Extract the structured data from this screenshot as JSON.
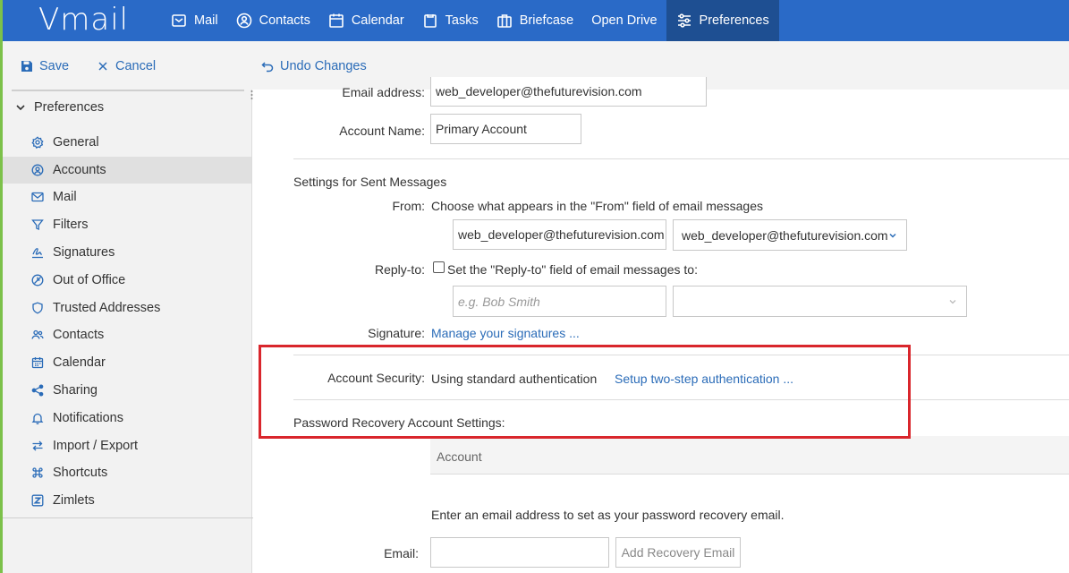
{
  "app": {
    "logo": "Vmail"
  },
  "nav": [
    {
      "label": "Mail",
      "icon": "mail-icon"
    },
    {
      "label": "Contacts",
      "icon": "contacts-icon"
    },
    {
      "label": "Calendar",
      "icon": "calendar-icon"
    },
    {
      "label": "Tasks",
      "icon": "tasks-icon"
    },
    {
      "label": "Briefcase",
      "icon": "briefcase-icon"
    },
    {
      "label": "Open Drive",
      "icon": ""
    },
    {
      "label": "Preferences",
      "icon": "sliders-icon"
    }
  ],
  "toolbar": {
    "save": "Save",
    "cancel": "Cancel",
    "undo": "Undo Changes"
  },
  "sidebar": {
    "header": "Preferences",
    "items": [
      {
        "label": "General",
        "icon": "gear-icon"
      },
      {
        "label": "Accounts",
        "icon": "account-icon"
      },
      {
        "label": "Mail",
        "icon": "mail-icon"
      },
      {
        "label": "Filters",
        "icon": "filter-icon"
      },
      {
        "label": "Signatures",
        "icon": "signature-icon"
      },
      {
        "label": "Out of Office",
        "icon": "out-of-office-icon"
      },
      {
        "label": "Trusted Addresses",
        "icon": "shield-icon"
      },
      {
        "label": "Contacts",
        "icon": "contacts-icon"
      },
      {
        "label": "Calendar",
        "icon": "calendar-icon"
      },
      {
        "label": "Sharing",
        "icon": "share-icon"
      },
      {
        "label": "Notifications",
        "icon": "bell-icon"
      },
      {
        "label": "Import / Export",
        "icon": "import-export-icon"
      },
      {
        "label": "Shortcuts",
        "icon": "command-icon"
      },
      {
        "label": "Zimlets",
        "icon": "zimlet-icon"
      }
    ]
  },
  "account": {
    "email_label": "Email address:",
    "email_value": "web_developer@thefuturevision.com",
    "name_label": "Account Name:",
    "name_value": "Primary Account"
  },
  "sent": {
    "section_title": "Settings for Sent Messages",
    "from_label": "From:",
    "from_desc": "Choose what appears in the \"From\" field of email messages",
    "from_name_value": "web_developer@thefuturevision.com",
    "from_address_selected": "web_developer@thefuturevision.com",
    "replyto_label": "Reply-to:",
    "replyto_desc": "Set the \"Reply-to\" field of email messages to:",
    "replyto_placeholder": "e.g. Bob Smith",
    "signature_label": "Signature:",
    "signature_link": "Manage your signatures ..."
  },
  "security": {
    "label": "Account Security:",
    "value": "Using standard authentication",
    "link": "Setup two-step authentication ..."
  },
  "recovery": {
    "title": "Password Recovery Account Settings:",
    "table_header": "Account",
    "desc": "Enter an email address to set as your password recovery email.",
    "email_label": "Email:",
    "add_button": "Add Recovery Email"
  },
  "colors": {
    "primary": "#2a6ac7",
    "active_nav": "#1e4f92",
    "accent_green": "#7cc14a",
    "link": "#2b6cb8",
    "highlight": "#d9262c"
  }
}
